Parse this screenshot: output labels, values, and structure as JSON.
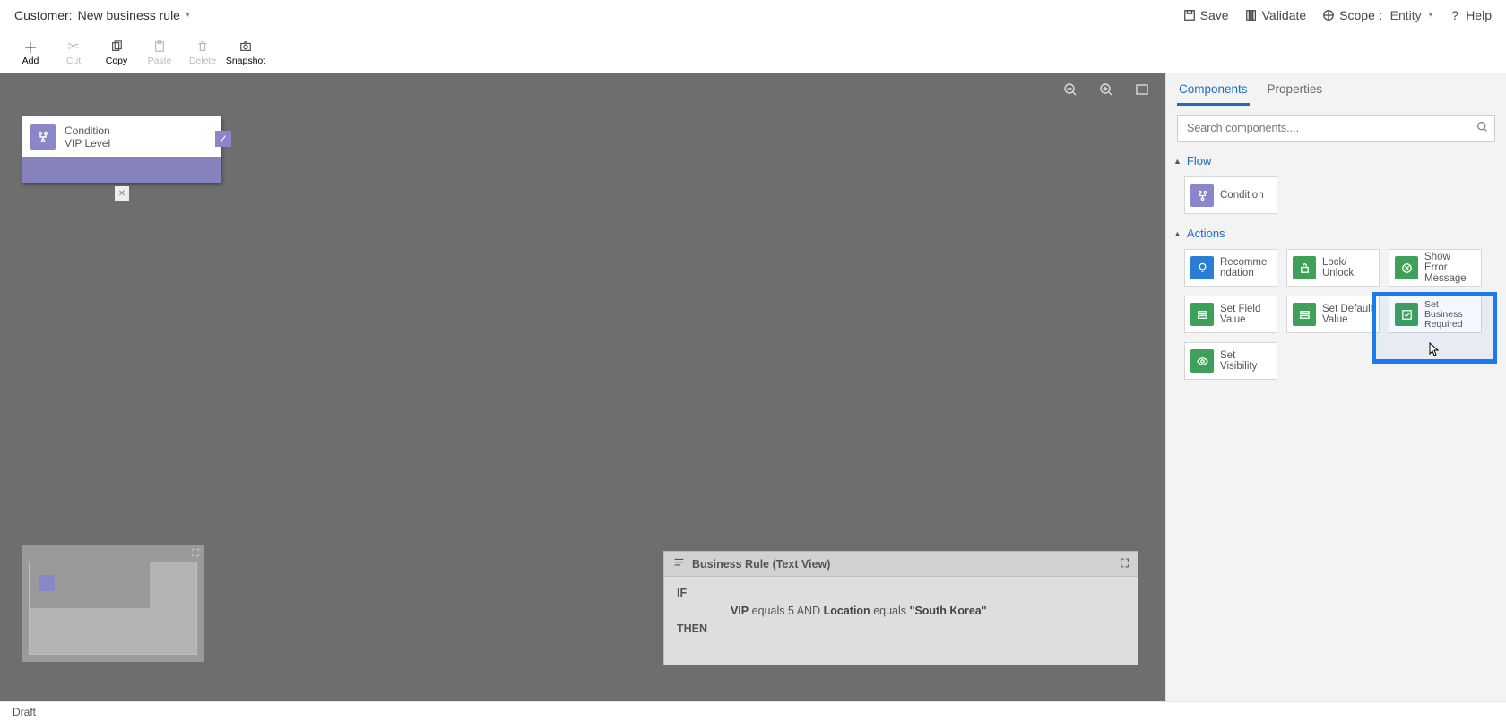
{
  "header": {
    "entity": "Customer:",
    "rule_name": "New business rule",
    "save": "Save",
    "validate": "Validate",
    "scope_label": "Scope :",
    "scope_value": "Entity",
    "help": "Help"
  },
  "toolbar": {
    "add": "Add",
    "cut": "Cut",
    "copy": "Copy",
    "paste": "Paste",
    "delete": "Delete",
    "snapshot": "Snapshot"
  },
  "canvas": {
    "condition": {
      "type": "Condition",
      "name": "VIP Level"
    }
  },
  "textview": {
    "title": "Business Rule (Text View)",
    "if": "IF",
    "then": "THEN",
    "field1": "VIP",
    "op1": "equals",
    "val1": "5",
    "and": "AND",
    "field2": "Location",
    "op2": "equals",
    "val2": "\"South Korea\""
  },
  "panel": {
    "tab_components": "Components",
    "tab_properties": "Properties",
    "search_ph": "Search components....",
    "group_flow": "Flow",
    "group_actions": "Actions",
    "items": {
      "condition": "Condition",
      "recommendation": "Recomme\nndation",
      "lock": "Lock/\nUnlock",
      "show_error": "Show Error\nMessage",
      "set_field": "Set Field\nValue",
      "set_default": "Set Default\nValue",
      "set_required": "Set\nBusiness\nRequired",
      "set_visibility": "Set\nVisibility"
    }
  },
  "status": {
    "state": "Draft"
  }
}
